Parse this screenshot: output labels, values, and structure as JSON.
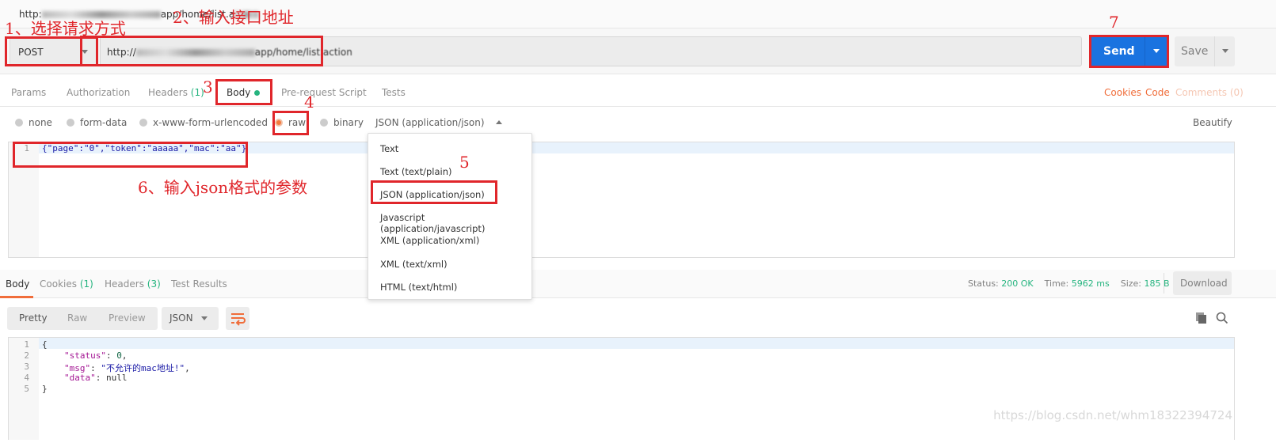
{
  "tab_title": {
    "prefix": "http:",
    "suffix": "app/home/list.a"
  },
  "request": {
    "method": "POST",
    "url_prefix": "http://",
    "url_suffix": "app/home/list.action",
    "send_label": "Send",
    "save_label": "Save"
  },
  "request_tabs": [
    {
      "label": "Params"
    },
    {
      "label": "Authorization"
    },
    {
      "label": "Headers",
      "count": "(1)"
    },
    {
      "label": "Body"
    },
    {
      "label": "Pre-request Script"
    },
    {
      "label": "Tests"
    }
  ],
  "request_links": {
    "cookies": "Cookies",
    "code": "Code",
    "comments": "Comments (0)"
  },
  "body_modes": [
    "none",
    "form-data",
    "x-www-form-urlencoded",
    "raw",
    "binary"
  ],
  "body_mode_selected": "raw",
  "content_type": "JSON (application/json)",
  "beautify": "Beautify",
  "body_editor": {
    "line": "1",
    "code": "{\"page\":\"0\",\"token\":\"aaaaa\",\"mac\":\"aa\"}"
  },
  "content_type_options": [
    "Text",
    "Text (text/plain)",
    "JSON (application/json)",
    "Javascript (application/javascript)",
    "XML (application/xml)",
    "XML (text/xml)",
    "HTML (text/html)"
  ],
  "response_tabs": [
    {
      "label": "Body"
    },
    {
      "label": "Cookies",
      "count": "(1)"
    },
    {
      "label": "Headers",
      "count": "(3)"
    },
    {
      "label": "Test Results"
    }
  ],
  "response_meta": {
    "status_label": "Status:",
    "status": "200 OK",
    "time_label": "Time:",
    "time": "5962 ms",
    "size_label": "Size:",
    "size": "185 B",
    "download": "Download"
  },
  "response_view": {
    "modes": [
      "Pretty",
      "Raw",
      "Preview"
    ],
    "format": "JSON"
  },
  "response_lines": [
    {
      "n": "1",
      "text": "{"
    },
    {
      "n": "2",
      "key": "\"status\"",
      "sep": ": ",
      "val": "0",
      "end": ","
    },
    {
      "n": "3",
      "key": "\"msg\"",
      "sep": ": ",
      "val": "\"不允许的mac地址!\"",
      "end": ","
    },
    {
      "n": "4",
      "key": "\"data\"",
      "sep": ": ",
      "val": "null",
      "end": ""
    },
    {
      "n": "5",
      "text": "}"
    }
  ],
  "annotations": {
    "a1": "1、选择请求方式",
    "a2": "2、输入接口地址",
    "a3": "3",
    "a4": "4",
    "a5": "5",
    "a6": "6、输入json格式的参数",
    "a7": "7"
  },
  "watermark": "https://blog.csdn.net/whm18322394724",
  "colors": {
    "accent": "#f06d3a",
    "send": "#1a73e0",
    "success": "#26b47f",
    "annotation": "#e0262b"
  }
}
